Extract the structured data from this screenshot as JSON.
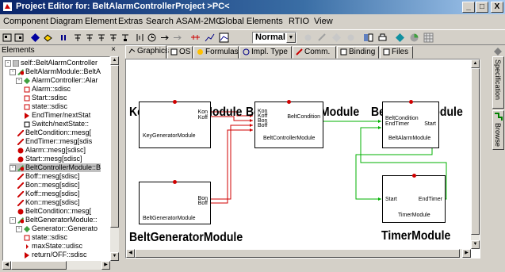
{
  "window": {
    "title": "Project Editor for: BeltAlarmControllerProject >PC<",
    "buttons": {
      "minimize": "_",
      "maximize": "□",
      "close": "X"
    }
  },
  "menu": [
    "Component",
    "Diagram",
    "Element",
    "Extras",
    "Search",
    "ASAM-2MC",
    "Global Elements",
    "RTIO",
    "View"
  ],
  "toolbar": {
    "zoom_value": "Normal"
  },
  "elements_panel": {
    "title": "Elements",
    "close_label": "×",
    "tree": [
      "self::BeltAlarmController",
      "BeltAlarmModule::BeltA",
      "AlarmController::Alar",
      "Alarm::sdisc",
      "Start::sdisc",
      "state::sdisc",
      "EndTimer/nextStat",
      "Switch/nextState::",
      "BeltCondition::mesg[",
      "EndTimer::mesg[sdis",
      "Alarm::mesg[sdisc]",
      "Start::mesg[sdisc]",
      "BeltControllerModule::B",
      "Boff::mesg[sdisc]",
      "Bon::mesg[sdisc]",
      "Koff::mesg[sdisc]",
      "Kon::mesg[sdisc]",
      "BeltCondition::mesg[",
      "BeltGeneratorModule::",
      "Generator::Generato",
      "state::sdisc",
      "maxState::udisc",
      "return/OFF::sdisc"
    ]
  },
  "tabs": [
    "Graphics",
    "OS",
    "Formulas",
    "Impl. Type",
    "Comm.",
    "Binding",
    "Files"
  ],
  "side_tabs": [
    "Specification",
    "Browse"
  ],
  "diagram": {
    "modules": {
      "key_generator": {
        "title": "KeyGeneratorModule",
        "label": "KeyGeneratorModule",
        "ports": [
          "Kon",
          "Koff"
        ]
      },
      "belt_controller": {
        "title": "BeltControllerModule",
        "label": "BeltControllerModule",
        "in_ports": [
          "Kon",
          "Koff",
          "Bon",
          "Boff"
        ],
        "out_port": "BeltCondition"
      },
      "belt_alarm": {
        "title": "BeltAlarmModule",
        "label": "BeltAlarmModule",
        "in_ports": [
          "BeltCondition",
          "EndTimer"
        ],
        "out_port": "Start"
      },
      "belt_generator": {
        "title": "BeltGeneratorModule",
        "label": "BeltGeneratorModule",
        "ports": [
          "Bon",
          "Boff"
        ]
      },
      "timer": {
        "title": "TimerModule",
        "label": "TimerModule",
        "in_port": "Start",
        "out_port": "EndTimer"
      }
    }
  },
  "colors": {
    "title_start": "#0a246a",
    "connection_red": "#d00000",
    "connection_green": "#00b000",
    "module_dot": "#d00000"
  }
}
